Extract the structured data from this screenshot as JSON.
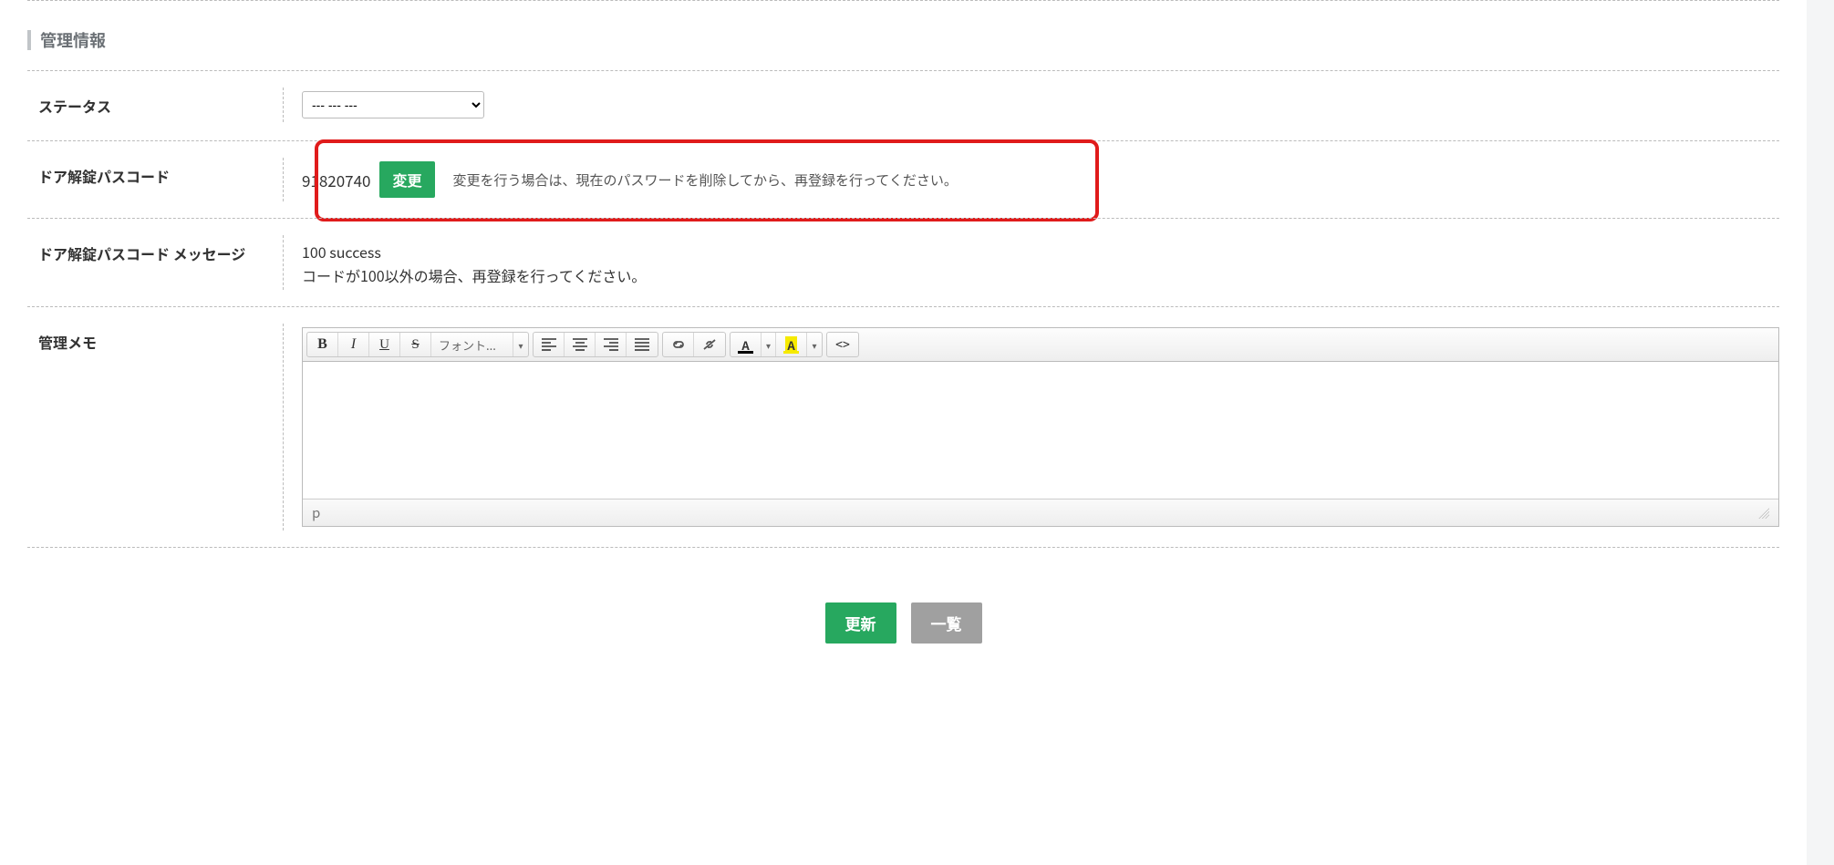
{
  "section": {
    "title": "管理情報"
  },
  "status": {
    "label": "ステータス",
    "placeholder": "--- --- ---"
  },
  "passcode": {
    "label": "ドア解錠パスコード",
    "value": "91820740",
    "change_btn": "変更",
    "hint": "変更を行う場合は、現在のパスワードを削除してから、再登録を行ってください。"
  },
  "passcode_msg": {
    "label": "ドア解錠パスコード メッセージ",
    "value": "100 success",
    "hint": "コードが100以外の場合、再登録を行ってください。"
  },
  "memo": {
    "label": "管理メモ",
    "toolbar": {
      "font_label": "フォント...",
      "text_color": "#000000",
      "bg_color": "#f6ea00"
    },
    "status_path": "p"
  },
  "footer": {
    "update_btn": "更新",
    "list_btn": "一覧"
  }
}
